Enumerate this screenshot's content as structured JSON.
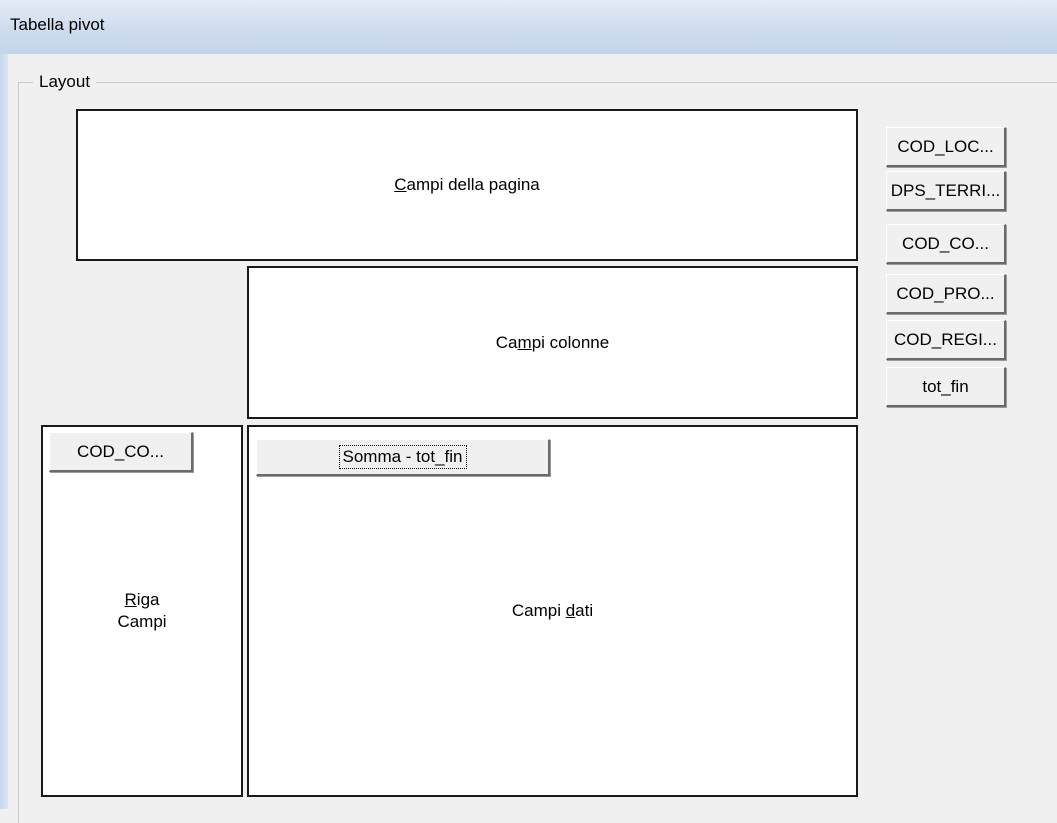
{
  "window": {
    "title": "Tabella pivot"
  },
  "layout_group": {
    "label": "Layout"
  },
  "zones": {
    "page_fields": {
      "prefix": "",
      "mnemonic": "C",
      "suffix": "ampi della pagina"
    },
    "column_fields": {
      "prefix": "Ca",
      "mnemonic": "m",
      "suffix": "pi colonne"
    },
    "row_fields": {
      "prefix": "",
      "mnemonic": "R",
      "suffix": "iga",
      "line2": "Campi"
    },
    "data_fields": {
      "prefix": "Campi ",
      "mnemonic": "d",
      "suffix": "ati"
    }
  },
  "row_zone_fields": [
    "COD_CO..."
  ],
  "data_zone_fields": [
    "Somma - tot_fin"
  ],
  "available_fields": [
    "COD_LOC...",
    "DPS_TERRI...",
    "COD_CO...",
    "COD_PRO...",
    "COD_REGI...",
    "tot_fin"
  ]
}
